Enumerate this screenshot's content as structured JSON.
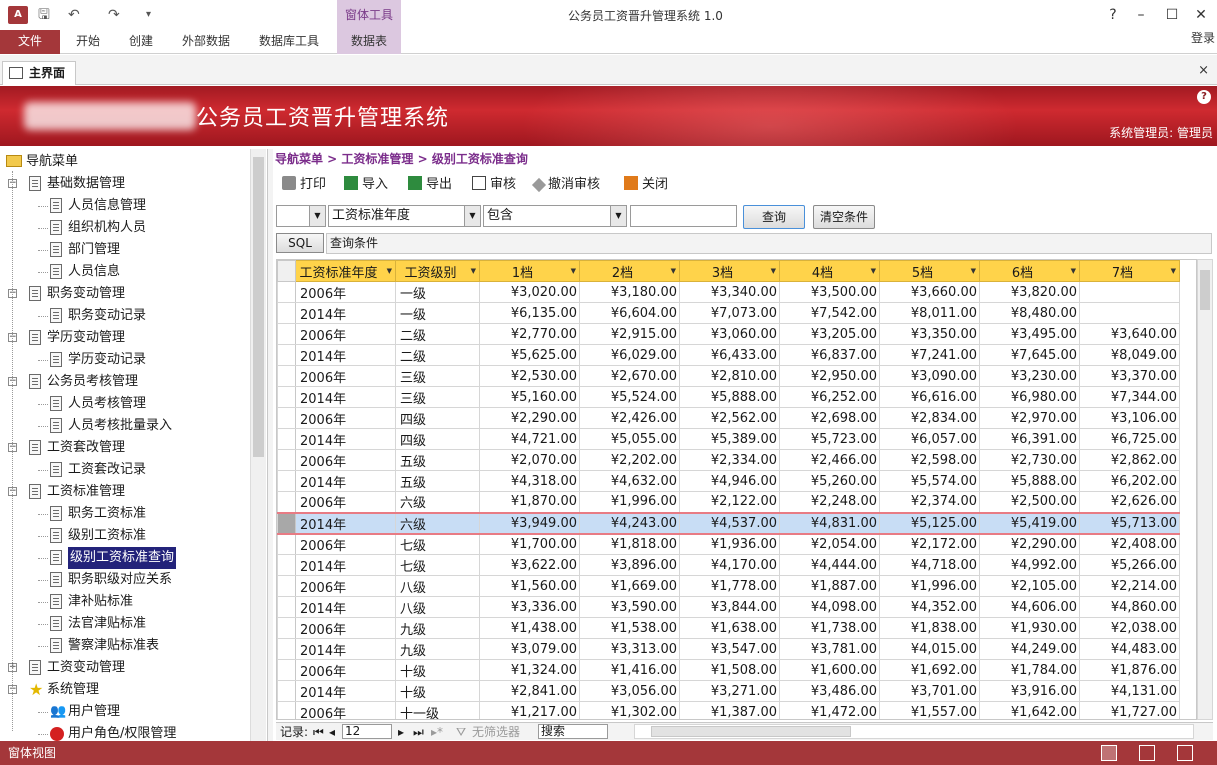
{
  "app": {
    "icon_label": "A",
    "window_title": "公务员工资晋升管理系统 1.0",
    "context_tab_group": "窗体工具",
    "help_glyph": "?",
    "minimize_glyph": "–",
    "maximize_glyph": "☐",
    "close_glyph": "✕",
    "login": "登录"
  },
  "ribbon": {
    "file": "文件",
    "tabs": [
      "开始",
      "创建",
      "外部数据",
      "数据库工具",
      "数据表"
    ]
  },
  "document_tab": {
    "label": "主界面",
    "close_glyph": "×"
  },
  "banner": {
    "title": "公务员工资晋升管理系统",
    "user": "系统管理员: 管理员",
    "help_glyph": "?"
  },
  "nav": {
    "root": "导航菜单",
    "items": [
      {
        "label": "基础数据管理",
        "level": 1,
        "expander": "−"
      },
      {
        "label": "人员信息管理",
        "level": 2
      },
      {
        "label": "组织机构人员",
        "level": 2
      },
      {
        "label": "部门管理",
        "level": 2
      },
      {
        "label": "人员信息",
        "level": 2
      },
      {
        "label": "职务变动管理",
        "level": 1,
        "expander": "−"
      },
      {
        "label": "职务变动记录",
        "level": 2
      },
      {
        "label": "学历变动管理",
        "level": 1,
        "expander": "−"
      },
      {
        "label": "学历变动记录",
        "level": 2
      },
      {
        "label": "公务员考核管理",
        "level": 1,
        "expander": "−"
      },
      {
        "label": "人员考核管理",
        "level": 2
      },
      {
        "label": "人员考核批量录入",
        "level": 2
      },
      {
        "label": "工资套改管理",
        "level": 1,
        "expander": "−"
      },
      {
        "label": "工资套改记录",
        "level": 2
      },
      {
        "label": "工资标准管理",
        "level": 1,
        "expander": "−"
      },
      {
        "label": "职务工资标准",
        "level": 2
      },
      {
        "label": "级别工资标准",
        "level": 2
      },
      {
        "label": "级别工资标准查询",
        "level": 2,
        "selected": true
      },
      {
        "label": "职务职级对应关系",
        "level": 2
      },
      {
        "label": "津补贴标准",
        "level": 2
      },
      {
        "label": "法官津贴标准",
        "level": 2
      },
      {
        "label": "警察津贴标准表",
        "level": 2
      },
      {
        "label": "工资变动管理",
        "level": 1,
        "expander": "+"
      },
      {
        "label": "系统管理",
        "level": 1,
        "expander": "−",
        "icon": "star"
      },
      {
        "label": "用户管理",
        "level": 2,
        "icon": "users"
      },
      {
        "label": "用户角色/权限管理",
        "level": 2,
        "icon": "stop"
      }
    ]
  },
  "breadcrumb": "导航菜单 > 工资标准管理 > 级别工资标准查询",
  "toolbar": {
    "buttons": [
      {
        "label": "打印",
        "icon": "printer-icon"
      },
      {
        "label": "导入",
        "icon": "import-icon"
      },
      {
        "label": "导出",
        "icon": "export-icon"
      },
      {
        "label": "审核",
        "icon": "audit-icon"
      },
      {
        "label": "撤消审核",
        "icon": "undo-audit-icon"
      },
      {
        "label": "关闭",
        "icon": "close-icon"
      }
    ]
  },
  "filter": {
    "logic_value": "",
    "field_value": "工资标准年度",
    "operator_value": "包含",
    "keyword_value": "",
    "query_button": "查询",
    "clear_button": "清空条件",
    "sql_button": "SQL",
    "sql_text": "查询条件"
  },
  "grid": {
    "columns": [
      "工资标准年度",
      "工资级别",
      "1档",
      "2档",
      "3档",
      "4档",
      "5档",
      "6档",
      "7档"
    ],
    "selected_row": 11,
    "rows": [
      [
        "2006年",
        "一级",
        "¥3,020.00",
        "¥3,180.00",
        "¥3,340.00",
        "¥3,500.00",
        "¥3,660.00",
        "¥3,820.00",
        ""
      ],
      [
        "2014年",
        "一级",
        "¥6,135.00",
        "¥6,604.00",
        "¥7,073.00",
        "¥7,542.00",
        "¥8,011.00",
        "¥8,480.00",
        ""
      ],
      [
        "2006年",
        "二级",
        "¥2,770.00",
        "¥2,915.00",
        "¥3,060.00",
        "¥3,205.00",
        "¥3,350.00",
        "¥3,495.00",
        "¥3,640.00"
      ],
      [
        "2014年",
        "二级",
        "¥5,625.00",
        "¥6,029.00",
        "¥6,433.00",
        "¥6,837.00",
        "¥7,241.00",
        "¥7,645.00",
        "¥8,049.00"
      ],
      [
        "2006年",
        "三级",
        "¥2,530.00",
        "¥2,670.00",
        "¥2,810.00",
        "¥2,950.00",
        "¥3,090.00",
        "¥3,230.00",
        "¥3,370.00"
      ],
      [
        "2014年",
        "三级",
        "¥5,160.00",
        "¥5,524.00",
        "¥5,888.00",
        "¥6,252.00",
        "¥6,616.00",
        "¥6,980.00",
        "¥7,344.00"
      ],
      [
        "2006年",
        "四级",
        "¥2,290.00",
        "¥2,426.00",
        "¥2,562.00",
        "¥2,698.00",
        "¥2,834.00",
        "¥2,970.00",
        "¥3,106.00"
      ],
      [
        "2014年",
        "四级",
        "¥4,721.00",
        "¥5,055.00",
        "¥5,389.00",
        "¥5,723.00",
        "¥6,057.00",
        "¥6,391.00",
        "¥6,725.00"
      ],
      [
        "2006年",
        "五级",
        "¥2,070.00",
        "¥2,202.00",
        "¥2,334.00",
        "¥2,466.00",
        "¥2,598.00",
        "¥2,730.00",
        "¥2,862.00"
      ],
      [
        "2014年",
        "五级",
        "¥4,318.00",
        "¥4,632.00",
        "¥4,946.00",
        "¥5,260.00",
        "¥5,574.00",
        "¥5,888.00",
        "¥6,202.00"
      ],
      [
        "2006年",
        "六级",
        "¥1,870.00",
        "¥1,996.00",
        "¥2,122.00",
        "¥2,248.00",
        "¥2,374.00",
        "¥2,500.00",
        "¥2,626.00"
      ],
      [
        "2014年",
        "六级",
        "¥3,949.00",
        "¥4,243.00",
        "¥4,537.00",
        "¥4,831.00",
        "¥5,125.00",
        "¥5,419.00",
        "¥5,713.00"
      ],
      [
        "2006年",
        "七级",
        "¥1,700.00",
        "¥1,818.00",
        "¥1,936.00",
        "¥2,054.00",
        "¥2,172.00",
        "¥2,290.00",
        "¥2,408.00"
      ],
      [
        "2014年",
        "七级",
        "¥3,622.00",
        "¥3,896.00",
        "¥4,170.00",
        "¥4,444.00",
        "¥4,718.00",
        "¥4,992.00",
        "¥5,266.00"
      ],
      [
        "2006年",
        "八级",
        "¥1,560.00",
        "¥1,669.00",
        "¥1,778.00",
        "¥1,887.00",
        "¥1,996.00",
        "¥2,105.00",
        "¥2,214.00"
      ],
      [
        "2014年",
        "八级",
        "¥3,336.00",
        "¥3,590.00",
        "¥3,844.00",
        "¥4,098.00",
        "¥4,352.00",
        "¥4,606.00",
        "¥4,860.00"
      ],
      [
        "2006年",
        "九级",
        "¥1,438.00",
        "¥1,538.00",
        "¥1,638.00",
        "¥1,738.00",
        "¥1,838.00",
        "¥1,930.00",
        "¥2,038.00"
      ],
      [
        "2014年",
        "九级",
        "¥3,079.00",
        "¥3,313.00",
        "¥3,547.00",
        "¥3,781.00",
        "¥4,015.00",
        "¥4,249.00",
        "¥4,483.00"
      ],
      [
        "2006年",
        "十级",
        "¥1,324.00",
        "¥1,416.00",
        "¥1,508.00",
        "¥1,600.00",
        "¥1,692.00",
        "¥1,784.00",
        "¥1,876.00"
      ],
      [
        "2014年",
        "十级",
        "¥2,841.00",
        "¥3,056.00",
        "¥3,271.00",
        "¥3,486.00",
        "¥3,701.00",
        "¥3,916.00",
        "¥4,131.00"
      ],
      [
        "2006年",
        "十一级",
        "¥1,217.00",
        "¥1,302.00",
        "¥1,387.00",
        "¥1,472.00",
        "¥1,557.00",
        "¥1,642.00",
        "¥1,727.00"
      ]
    ]
  },
  "record_nav": {
    "label": "记录:",
    "current": "12",
    "filter_label": "无筛选器",
    "search_placeholder": "搜索"
  },
  "status": {
    "text": "窗体视图"
  }
}
